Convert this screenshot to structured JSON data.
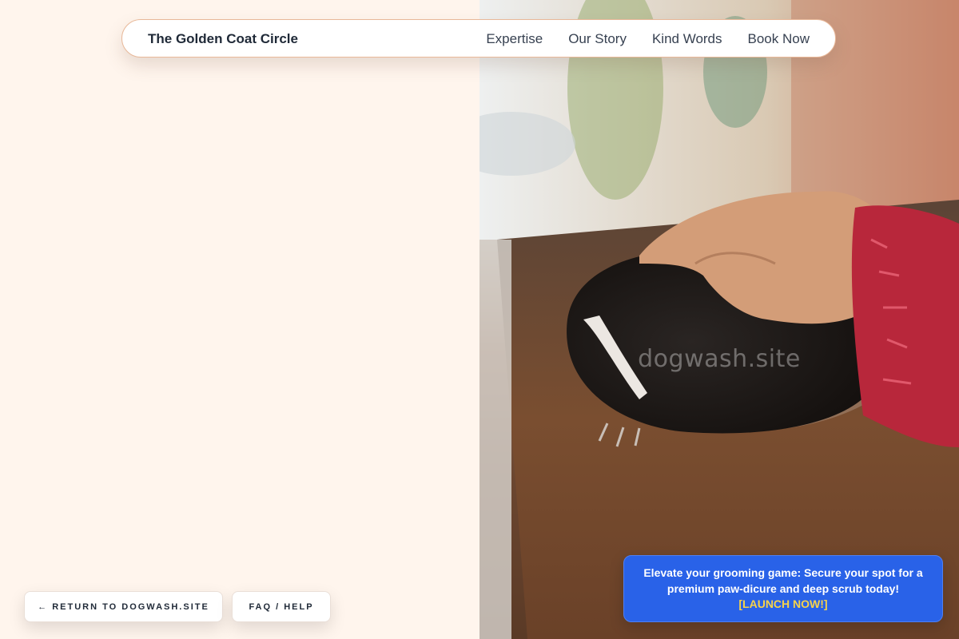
{
  "nav": {
    "brand": "The Golden Coat Circle",
    "links": [
      "Expertise",
      "Our Story",
      "Kind Words",
      "Book Now"
    ]
  },
  "hero_image": {
    "description_icon": "photo-skunk-petted",
    "watermark": "dogwash.site"
  },
  "buttons": {
    "return_label": "← RETURN TO DOGWASH.SITE",
    "faq_label": "FAQ / HELP"
  },
  "promo": {
    "text": "Elevate your grooming game: Secure your spot for a premium paw-dicure and deep scrub today!",
    "cta": "[LAUNCH NOW!]"
  },
  "colors": {
    "background": "#fff5ed",
    "promo": "#2962e8",
    "cta": "#f7d34a",
    "nav_border": "#e8b899"
  }
}
